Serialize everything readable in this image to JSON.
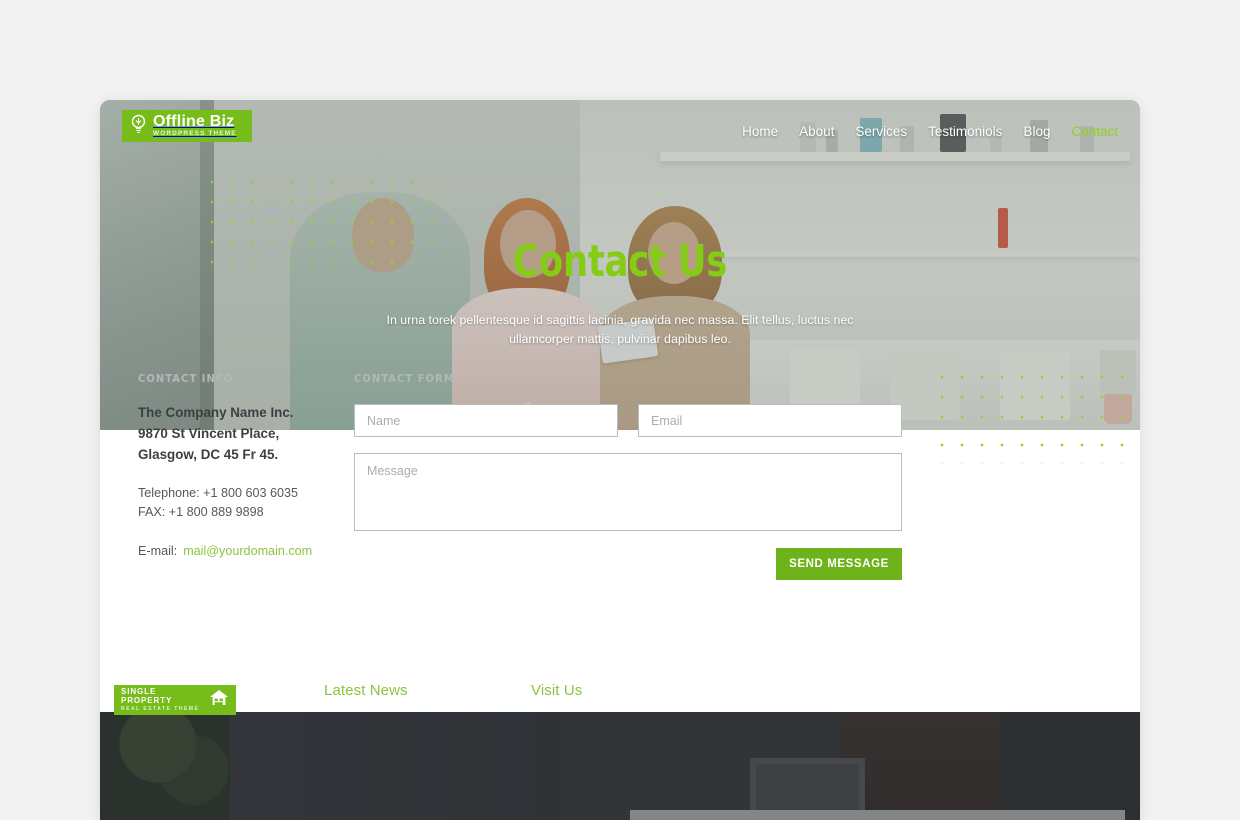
{
  "site": {
    "logo": {
      "name": "Offline Biz",
      "tagline": "WORDPRESS THEME",
      "icon": "lightbulb-icon",
      "bg_color": "#76bc1b"
    },
    "accent_green": "#8cc540",
    "button_green": "#6eb31b",
    "page_bg": "#f2f2f2"
  },
  "nav": {
    "items": [
      {
        "label": "Home",
        "active": false
      },
      {
        "label": "About",
        "active": false
      },
      {
        "label": "Services",
        "active": false
      },
      {
        "label": "Testimoniols",
        "active": false
      },
      {
        "label": "Blog",
        "active": false
      },
      {
        "label": "Contact",
        "active": true
      }
    ]
  },
  "hero": {
    "title": "Contact Us",
    "subtitle": "In urna torek pellentesque id sagittis lacinia, gravida nec massa. Elit tellus, luctus nec ullamcorper mattis, pulvinar dapibus leo.",
    "title_color": "#84cc16",
    "decoration": "green-dot-grid"
  },
  "contact_info": {
    "label": "CONTACT INFO",
    "company": "The Company Name Inc.",
    "address_line1": "9870 St Vincent Place,",
    "address_line2": "Glasgow, DC 45 Fr 45.",
    "telephone": "Telephone: +1 800 603 6035",
    "fax": "FAX: +1 800 889 9898",
    "email_label": "E-mail:",
    "email": "mail@yourdomain.com"
  },
  "contact_form": {
    "label": "CONTACT FORM",
    "name_placeholder": "Name",
    "email_placeholder": "Email",
    "message_placeholder": "Message",
    "name_value": "",
    "email_value": "",
    "message_value": "",
    "submit_label": "SEND MESSAGE"
  },
  "footer": {
    "badge": {
      "line1": "SINGLE PROPERTY",
      "line2": "REAL ESTATE THEME",
      "icon": "house-icon"
    },
    "latest_news": "Latest News",
    "visit_us": "Visit Us"
  }
}
